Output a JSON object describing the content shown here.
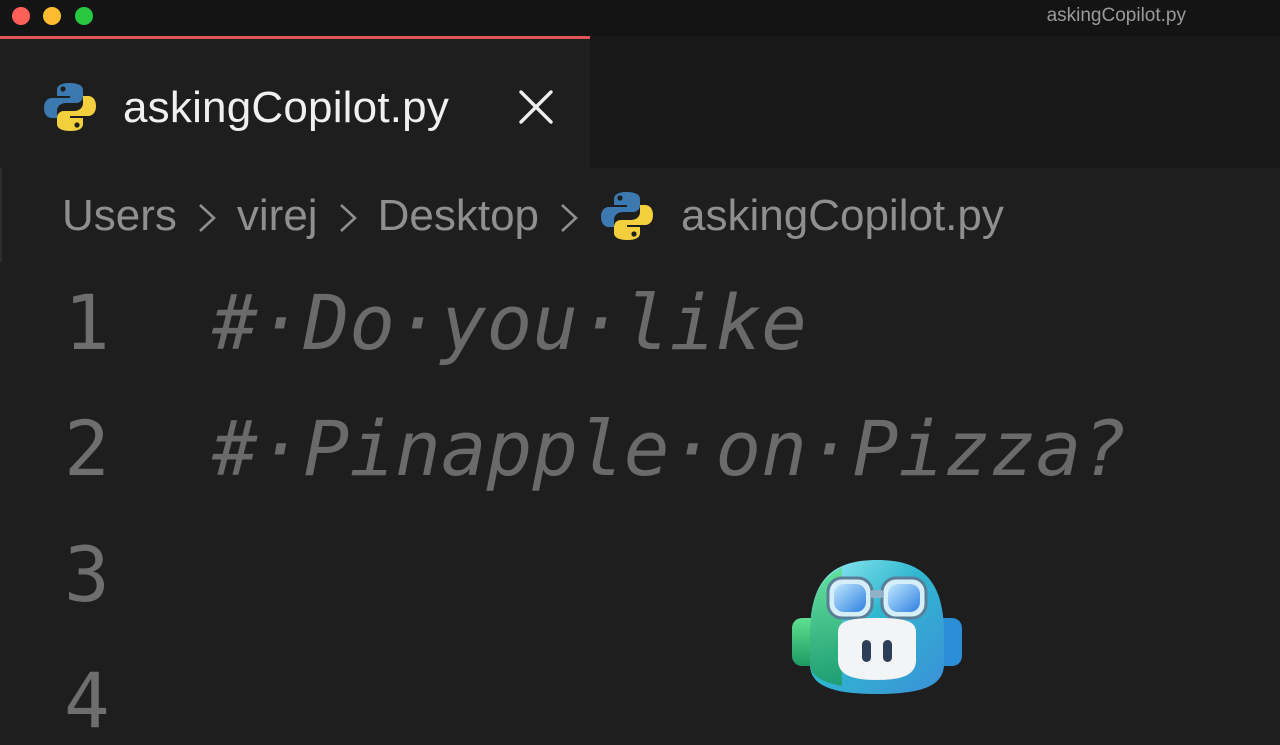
{
  "window": {
    "title": "askingCopilot.py"
  },
  "tab": {
    "label": "askingCopilot.py",
    "close_icon": "close-icon",
    "file_icon": "python-icon"
  },
  "breadcrumb": {
    "items": [
      "Users",
      "virej",
      "Desktop",
      "askingCopilot.py"
    ],
    "separator_icon": "chevron-right-icon"
  },
  "editor": {
    "lines": [
      {
        "number": "1",
        "text": "#·Do·you·like"
      },
      {
        "number": "2",
        "text": "#·Pinapple·on·Pizza?"
      },
      {
        "number": "3",
        "text": ""
      },
      {
        "number": "4",
        "text": ""
      }
    ]
  },
  "overlay": {
    "icon": "copilot-mascot-icon"
  },
  "colors": {
    "active_tab_border": "#e0555a",
    "editor_bg": "#1e1e1e",
    "tab_bar_bg": "#181818",
    "comment": "#6a6a6a"
  }
}
